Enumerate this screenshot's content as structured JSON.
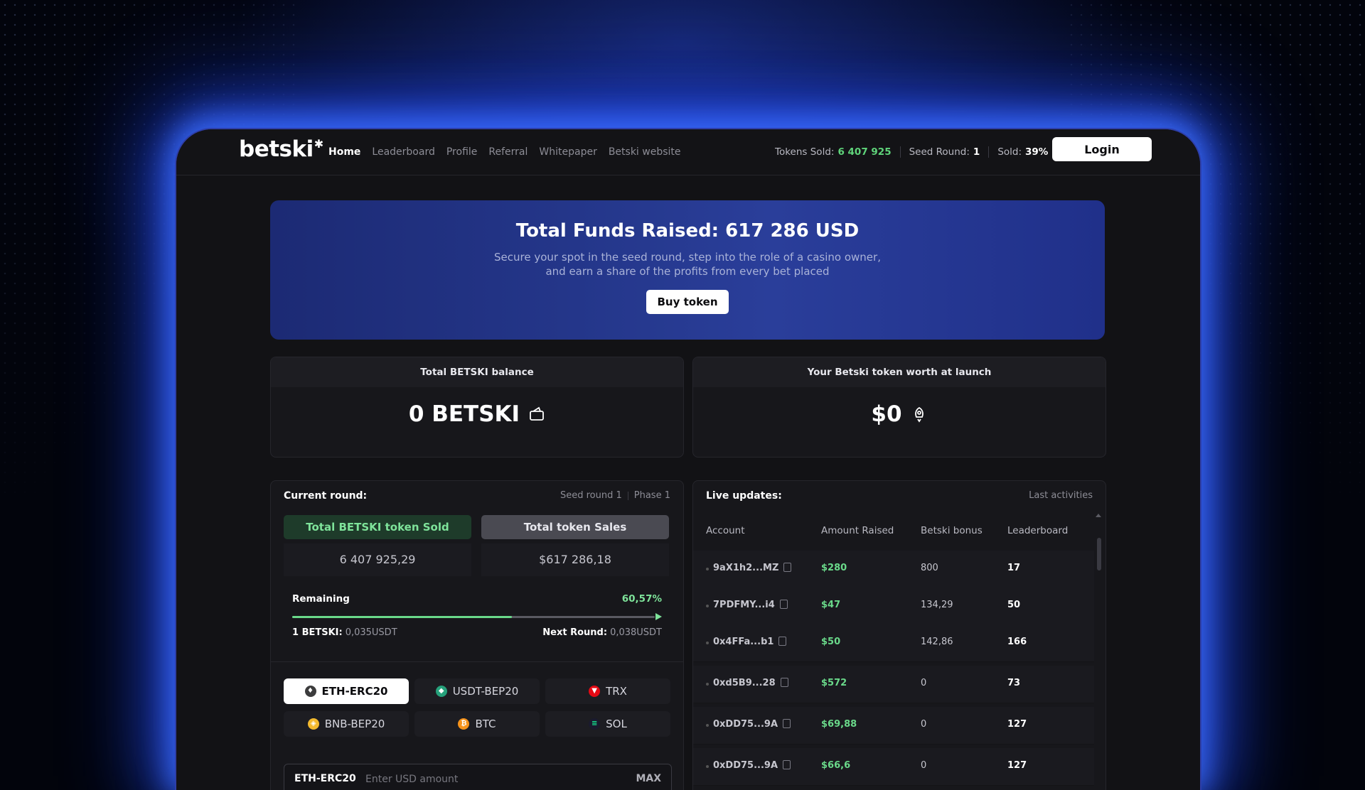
{
  "header": {
    "logo": "betski",
    "logo_star": "✱",
    "nav": [
      "Home",
      "Leaderboard",
      "Profile",
      "Referral",
      "Whitepaper",
      "Betski website"
    ],
    "tokens_sold_label": "Tokens Sold:",
    "tokens_sold_value": "6 407 925",
    "seed_round_label": "Seed Round:",
    "seed_round_value": "1",
    "sold_label": "Sold:",
    "sold_value": "39%",
    "login_label": "Login"
  },
  "hero": {
    "title": "Total Funds Raised: 617 286 USD",
    "subtitle_line1": "Secure your spot in the seed round, step into the role of a casino owner,",
    "subtitle_line2": "and earn a share of the profits from every bet placed",
    "buy_label": "Buy token"
  },
  "balance": {
    "title": "Total BETSKI balance",
    "value": "0 BETSKI",
    "icon": "wallet-icon"
  },
  "worth": {
    "title": "Your Betski token worth at launch",
    "value": "$0",
    "icon": "rocket-icon"
  },
  "round": {
    "label": "Current round:",
    "seed": "Seed round 1",
    "phase": "Phase 1",
    "sold_tab": "Total BETSKI token Sold",
    "sales_tab": "Total token Sales",
    "sold_value": "6 407 925,29",
    "sales_value": "$617 286,18",
    "remaining_label": "Remaining",
    "remaining_pct": "60,57%",
    "progress_fraction": 0.6057,
    "price_label": "1 BETSKI:",
    "price_value": "0,035USDT",
    "next_label": "Next Round:",
    "next_value": "0,038USDT"
  },
  "coins": [
    {
      "label": "ETH-ERC20",
      "color": "#3c3c3d",
      "glyph": "♦",
      "active": true
    },
    {
      "label": "USDT-BEP20",
      "color": "#26a17b",
      "glyph": "◆",
      "active": false
    },
    {
      "label": "TRX",
      "color": "#e50914",
      "glyph": "▼",
      "active": false
    },
    {
      "label": "BNB-BEP20",
      "color": "#f3ba2f",
      "glyph": "◈",
      "active": false
    },
    {
      "label": "BTC",
      "color": "#f7931a",
      "glyph": "₿",
      "active": false
    },
    {
      "label": "SOL",
      "color": "#14f195",
      "glyph": "≡",
      "active": false
    }
  ],
  "amount": {
    "currency": "ETH-ERC20",
    "placeholder": "Enter USD amount",
    "max_label": "MAX"
  },
  "live": {
    "title": "Live updates:",
    "subtitle": "Last activities",
    "columns": [
      "Account",
      "Amount Raised",
      "Betski bonus",
      "Leaderboard"
    ],
    "rows": [
      {
        "account": "9aX1h2...MZ",
        "amount": "$280",
        "bonus": "800",
        "lb": "17"
      },
      {
        "account": "7PDFMY...i4",
        "amount": "$47",
        "bonus": "134,29",
        "lb": "50"
      },
      {
        "account": "0x4FFa...b1",
        "amount": "$50",
        "bonus": "142,86",
        "lb": "166"
      },
      {
        "account": "0xd5B9...28",
        "amount": "$572",
        "bonus": "0",
        "lb": "73"
      },
      {
        "account": "0xDD75...9A",
        "amount": "$69,88",
        "bonus": "0",
        "lb": "127"
      },
      {
        "account": "0xDD75...9A",
        "amount": "$66,6",
        "bonus": "0",
        "lb": "127"
      }
    ]
  }
}
